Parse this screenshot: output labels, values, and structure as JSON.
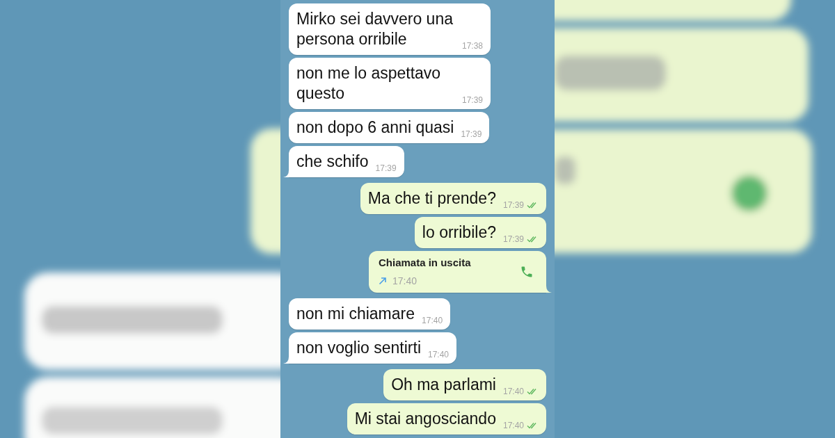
{
  "messages": [
    {
      "kind": "text",
      "outgoing": false,
      "tail": false,
      "text": "Mirko sei davvero una persona orribile",
      "time": "17:38"
    },
    {
      "kind": "text",
      "outgoing": false,
      "tail": false,
      "text": "non me lo aspettavo questo",
      "time": "17:39"
    },
    {
      "kind": "text",
      "outgoing": false,
      "tail": false,
      "text": "non dopo 6 anni quasi",
      "time": "17:39"
    },
    {
      "kind": "text",
      "outgoing": false,
      "tail": true,
      "text": "che schifo",
      "time": "17:39"
    },
    {
      "kind": "text",
      "outgoing": true,
      "tail": false,
      "read": true,
      "text": "Ma che ti prende?",
      "time": "17:39"
    },
    {
      "kind": "text",
      "outgoing": true,
      "tail": false,
      "read": true,
      "text": "lo orribile?",
      "time": "17:39"
    },
    {
      "kind": "call",
      "outgoing": true,
      "tail": true,
      "text": "Chiamata in uscita",
      "time": "17:40"
    },
    {
      "kind": "text",
      "outgoing": false,
      "tail": false,
      "text": "non mi chiamare",
      "time": "17:40"
    },
    {
      "kind": "text",
      "outgoing": false,
      "tail": true,
      "text": "non voglio sentirti",
      "time": "17:40"
    },
    {
      "kind": "text",
      "outgoing": true,
      "tail": false,
      "read": true,
      "text": "Oh ma parlami",
      "time": "17:40"
    },
    {
      "kind": "text",
      "outgoing": true,
      "tail": false,
      "read": true,
      "text": "Mi stai angosciando",
      "time": "17:40"
    }
  ]
}
